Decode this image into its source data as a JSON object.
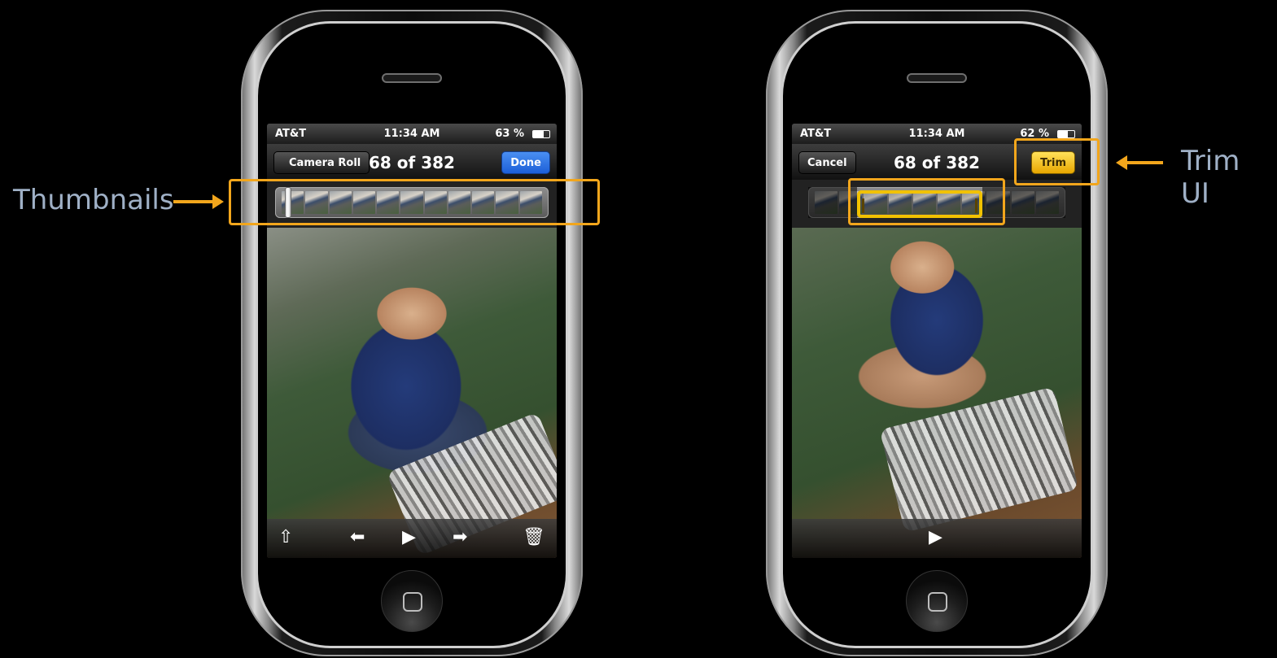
{
  "annotations": {
    "thumbnails_label": "Thumbnails",
    "trim_label": "Trim UI",
    "accent_color": "#f2a61c"
  },
  "left_phone": {
    "status": {
      "carrier": "AT&T",
      "time": "11:34 AM",
      "battery": "63 %",
      "battery_level": 0.63
    },
    "nav": {
      "back_label": "Camera Roll",
      "title": "68 of 382",
      "done_label": "Done"
    },
    "toolbar": {
      "share_icon": "share-icon",
      "prev_icon": "previous-icon",
      "play_icon": "play-icon",
      "next_icon": "next-icon",
      "trash_icon": "trash-icon"
    }
  },
  "right_phone": {
    "status": {
      "carrier": "AT&T",
      "time": "11:34 AM",
      "battery": "62 %",
      "battery_level": 0.62
    },
    "nav": {
      "cancel_label": "Cancel",
      "title": "68 of 382",
      "trim_label": "Trim"
    },
    "toolbar": {
      "play_icon": "play-icon"
    }
  }
}
